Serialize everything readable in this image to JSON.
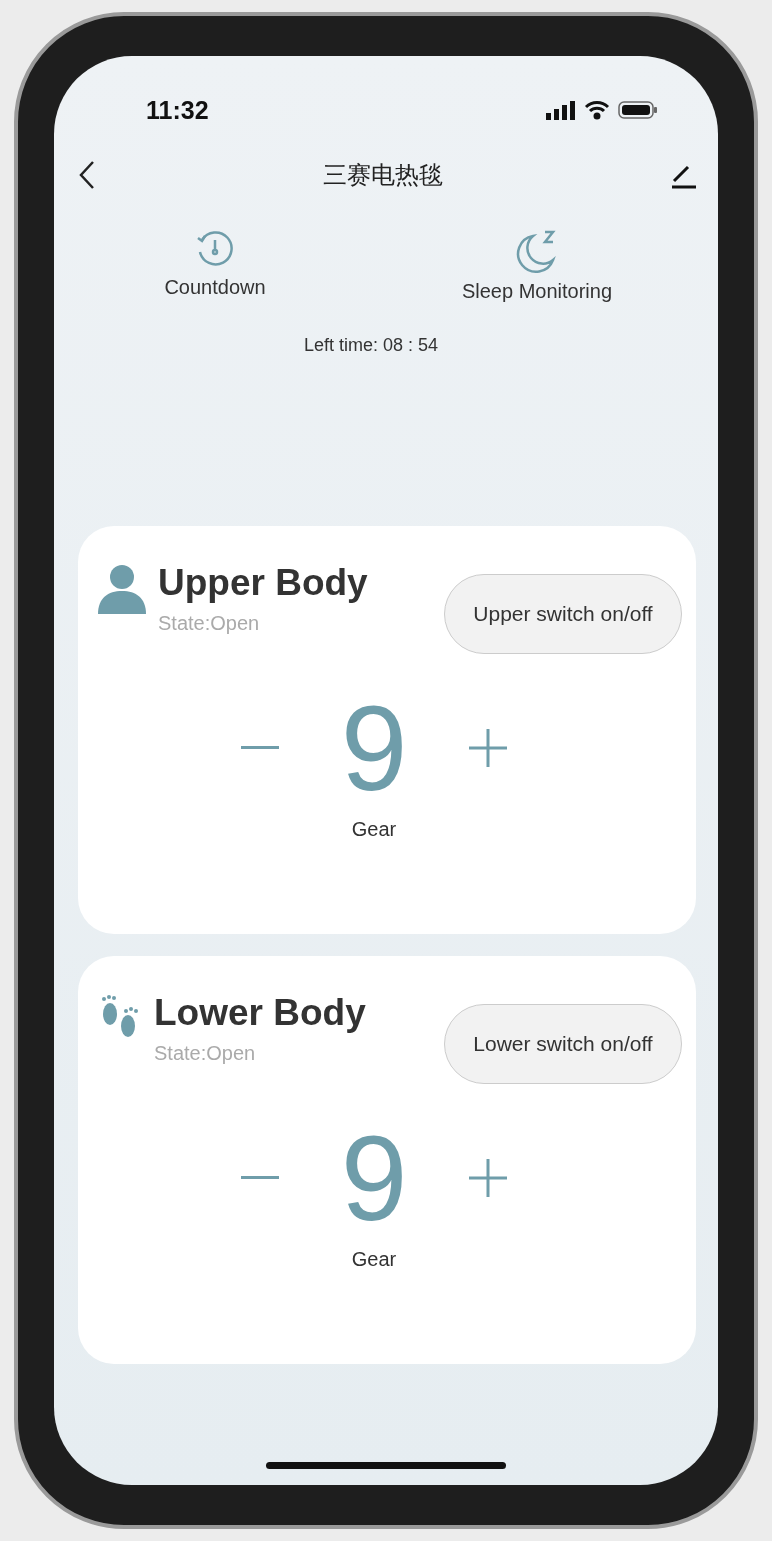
{
  "status_bar": {
    "time": "11:32"
  },
  "nav": {
    "title": "三赛电热毯"
  },
  "features": [
    {
      "kind": "countdown",
      "label": "Countdown"
    },
    {
      "kind": "sleep",
      "label": "Sleep Monitoring"
    }
  ],
  "left_time": "Left time: 08 : 54",
  "zones": [
    {
      "kind": "upper",
      "title": "Upper Body",
      "state": "State:Open",
      "switch_label": "Upper switch on/off",
      "gear": "9",
      "gear_label": "Gear"
    },
    {
      "kind": "lower",
      "title": "Lower Body",
      "state": "State:Open",
      "switch_label": "Lower switch on/off",
      "gear": "9",
      "gear_label": "Gear"
    }
  ]
}
